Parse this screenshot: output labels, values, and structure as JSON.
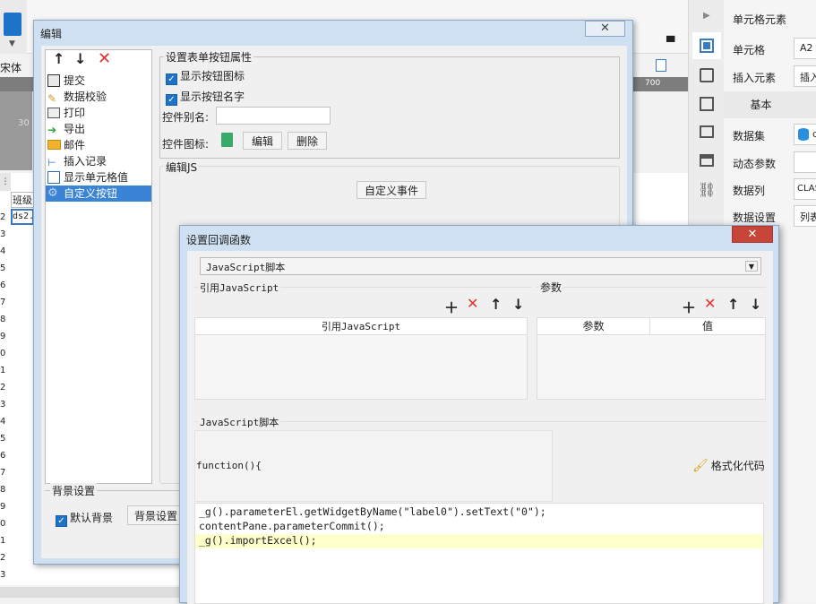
{
  "background_app": {
    "font_label": "宋体",
    "ruler_label": "700",
    "ruler_left_label": "30",
    "grid_col_header": "班级",
    "grid_cell": "ds2.",
    "row_numbers": [
      "2",
      "3",
      "4",
      "5",
      "6",
      "7",
      "8",
      "9",
      "0",
      "1",
      "2",
      "3",
      "4",
      "5",
      "6",
      "7",
      "8",
      "9",
      "0",
      "1",
      "2",
      "3"
    ]
  },
  "right_panel": {
    "header": "单元格元素",
    "cell_label": "单元格",
    "cell_value": "A2",
    "insert_label": "插入元素",
    "insert_value": "插入",
    "basic_header": "基本",
    "dataset_label": "数据集",
    "dataset_value": "d",
    "dynparam_label": "动态参数",
    "datacol_label": "数据列",
    "datacol_value": "CLAS",
    "dataset_setting_label": "数据设置",
    "dataset_setting_value": "列表"
  },
  "edit_dialog": {
    "title": "编辑",
    "list_items": [
      {
        "label": "提交",
        "icon": "submit-icon"
      },
      {
        "label": "数据校验",
        "icon": "check-icon"
      },
      {
        "label": "打印",
        "icon": "print-icon"
      },
      {
        "label": "导出",
        "icon": "export-icon"
      },
      {
        "label": "邮件",
        "icon": "mail-icon"
      },
      {
        "label": "插入记录",
        "icon": "insert-record-icon"
      },
      {
        "label": "显示单元格值",
        "icon": "cell-value-icon"
      },
      {
        "label": "自定义按钮",
        "icon": "gear-icon"
      }
    ],
    "props_group": "设置表单按钮属性",
    "show_icon": "显示按钮图标",
    "show_name": "显示按钮名字",
    "alias_label": "控件别名:",
    "alias_value": "",
    "icon_label": "控件图标:",
    "edit_btn": "编辑",
    "delete_btn": "删除",
    "js_group": "编辑JS",
    "custom_event_btn": "自定义事件",
    "bg_group": "背景设置",
    "default_bg": "默认背景",
    "bg_setting_btn": "背景设置"
  },
  "callback_dialog": {
    "title": "设置回调函数",
    "select_value": "JavaScript脚本",
    "ref_js_group": "引用JavaScript",
    "param_group": "参数",
    "ref_js_col": "引用JavaScript",
    "param_col": "参数",
    "value_col": "值",
    "js_script_label": "JavaScript脚本",
    "function_label": "function(){",
    "format_btn": "格式化代码",
    "code_lines": [
      {
        "id": "line1",
        "text": "_g().parameterEl.getWidgetByName(\"label0\").setText(\"0\");"
      },
      {
        "id": "line2",
        "text": "contentPane.parameterCommit();"
      },
      {
        "id": "line3",
        "text": "_g().importExcel();"
      }
    ],
    "active_line_color": "#ffffcc"
  }
}
